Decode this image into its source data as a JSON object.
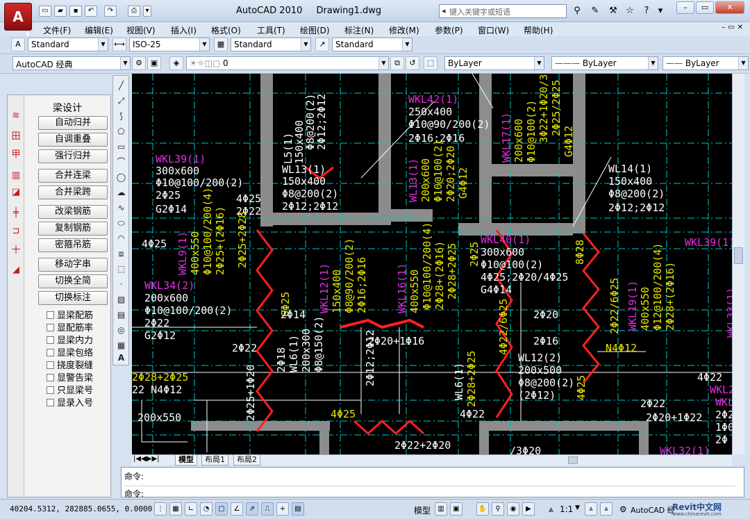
{
  "window": {
    "app_name": "AutoCAD 2010",
    "doc_name": "Drawing1.dwg",
    "search_placeholder": "键入关键字或短语",
    "logo_letter": "A"
  },
  "menu": [
    "文件(F)",
    "编辑(E)",
    "视图(V)",
    "插入(I)",
    "格式(O)",
    "工具(T)",
    "绘图(D)",
    "标注(N)",
    "修改(M)",
    "参数(P)",
    "窗口(W)",
    "帮助(H)"
  ],
  "styles_toolbar": {
    "text_style": "Standard",
    "dim_style": "ISO-25",
    "table_style": "Standard",
    "mleader_style": "Standard"
  },
  "workspace_toolbar": {
    "workspace": "AutoCAD 经典",
    "layer": "0",
    "color": "ByLayer",
    "linetype": "ByLayer",
    "lineweight": "ByLayer"
  },
  "beam_panel": {
    "title": "梁设计",
    "buttons": [
      "自动归并",
      "自调重叠",
      "强行归并",
      "合并连梁",
      "合并梁跨",
      "改梁钢筋",
      "复制钢筋",
      "密箍吊筋",
      "移动字串",
      "切换全简",
      "切换标注"
    ],
    "checkboxes": [
      "显梁配筋",
      "显配筋率",
      "显梁内力",
      "显梁包络",
      "挠度裂缝",
      "显警告梁",
      "只显梁号",
      "显录入号"
    ]
  },
  "layout_tabs": [
    "模型",
    "布局1",
    "布局2"
  ],
  "command": {
    "line1": "命令:",
    "line2": "命令:"
  },
  "status": {
    "coords": "40204.5312, 282885.0655, 0.0000",
    "model_label": "模型",
    "scale": "1:1",
    "workspace_label": "AutoCAD 经"
  },
  "watermark": {
    "title": "Revit中文网",
    "url": "www.chinarevit.com"
  },
  "drawing": {
    "colors": {
      "background": "#000000",
      "white": "#ffffff",
      "magenta": "#e02ee0",
      "yellow": "#e6e600",
      "cyan": "#00c8c8",
      "red": "#ff2020",
      "gray": "#8c8c8c"
    },
    "labels": [
      {
        "text": "WKL39(1)",
        "color": "magenta"
      },
      {
        "text": "300x600",
        "color": "white"
      },
      {
        "text": "Φ10@100/200(2)",
        "color": "white"
      },
      {
        "text": "2Φ25",
        "color": "white"
      },
      {
        "text": "G2Φ14",
        "color": "white"
      },
      {
        "text": "4Φ25",
        "color": "white"
      },
      {
        "text": "2Φ22",
        "color": "white"
      },
      {
        "text": "4Φ25",
        "color": "white"
      },
      {
        "text": "L5(1)",
        "color": "white"
      },
      {
        "text": "150x400",
        "color": "white"
      },
      {
        "text": "Φ8@200(2)",
        "color": "white"
      },
      {
        "text": "2Φ12;2Φ12",
        "color": "white"
      },
      {
        "text": "WL13(1)",
        "color": "white"
      },
      {
        "text": "150x400",
        "color": "white"
      },
      {
        "text": "Φ8@200(2)",
        "color": "white"
      },
      {
        "text": "2Φ12;2Φ12",
        "color": "white"
      },
      {
        "text": "WKL42(1)",
        "color": "magenta"
      },
      {
        "text": "250x400",
        "color": "white"
      },
      {
        "text": "Φ10@90/200(2)",
        "color": "white"
      },
      {
        "text": "2Φ16;2Φ16",
        "color": "white"
      },
      {
        "text": "WL13(1)",
        "color": "magenta"
      },
      {
        "text": "200x600",
        "color": "yellow"
      },
      {
        "text": "Φ10@100(2)",
        "color": "yellow"
      },
      {
        "text": "2Φ20;2Φ20",
        "color": "yellow"
      },
      {
        "text": "G4Φ12",
        "color": "yellow"
      },
      {
        "text": "WKL17(1)",
        "color": "magenta"
      },
      {
        "text": "200x600",
        "color": "yellow"
      },
      {
        "text": "Φ10@100(2)",
        "color": "yellow"
      },
      {
        "text": "3Φ22+1Φ20/3Φ20",
        "color": "yellow"
      },
      {
        "text": "2Φ25/2Φ25",
        "color": "yellow"
      },
      {
        "text": "G4Φ12",
        "color": "yellow"
      },
      {
        "text": "WL14(1)",
        "color": "white"
      },
      {
        "text": "150x400",
        "color": "white"
      },
      {
        "text": "Φ8@200(2)",
        "color": "white"
      },
      {
        "text": "2Φ12;2Φ12",
        "color": "white"
      },
      {
        "text": "WKL39(1)",
        "color": "magenta"
      },
      {
        "text": "WKL9(1)",
        "color": "magenta"
      },
      {
        "text": "400x550",
        "color": "yellow"
      },
      {
        "text": "Φ10@100/200(4)",
        "color": "yellow"
      },
      {
        "text": "2Φ25+(2Φ16)",
        "color": "yellow"
      },
      {
        "text": "2Φ25+2Φ28",
        "color": "yellow"
      },
      {
        "text": "WKL34(2)",
        "color": "magenta"
      },
      {
        "text": "200x600",
        "color": "white"
      },
      {
        "text": "Φ10@100/200(2)",
        "color": "white"
      },
      {
        "text": "2Φ22",
        "color": "white"
      },
      {
        "text": "G2Φ12",
        "color": "white"
      },
      {
        "text": "6Φ25",
        "color": "yellow"
      },
      {
        "text": "2Φ14",
        "color": "white"
      },
      {
        "text": "2Φ22",
        "color": "white"
      },
      {
        "text": "WKL12(1)",
        "color": "magenta"
      },
      {
        "text": "150x400",
        "color": "yellow"
      },
      {
        "text": "Φ8@90/200(2)",
        "color": "yellow"
      },
      {
        "text": "2Φ16;2Φ16",
        "color": "yellow"
      },
      {
        "text": "WKL16(1)",
        "color": "magenta"
      },
      {
        "text": "400x550",
        "color": "yellow"
      },
      {
        "text": "Φ10@100/200(4)",
        "color": "yellow"
      },
      {
        "text": "2Φ28+(2Φ16)",
        "color": "yellow"
      },
      {
        "text": "2Φ28+2Φ25",
        "color": "yellow"
      },
      {
        "text": "WKL40(1)",
        "color": "magenta"
      },
      {
        "text": "300x600",
        "color": "white"
      },
      {
        "text": "Φ10@100(2)",
        "color": "white"
      },
      {
        "text": "4Φ25;2Φ20/4Φ25",
        "color": "white"
      },
      {
        "text": "G4Φ14",
        "color": "white"
      },
      {
        "text": "8Φ28",
        "color": "yellow"
      },
      {
        "text": "2Φ25",
        "color": "yellow"
      },
      {
        "text": "2Φ20",
        "color": "white"
      },
      {
        "text": "2Φ16",
        "color": "white"
      },
      {
        "text": "4Φ22/6Φ25",
        "color": "yellow"
      },
      {
        "text": "WL12(2)",
        "color": "white"
      },
      {
        "text": "200x500",
        "color": "white"
      },
      {
        "text": "Φ8@200(2)",
        "color": "white"
      },
      {
        "text": "(2Φ12)",
        "color": "white"
      },
      {
        "text": "2Φ22/6Φ25",
        "color": "yellow"
      },
      {
        "text": "WKL19(1)",
        "color": "magenta"
      },
      {
        "text": "400x550",
        "color": "yellow"
      },
      {
        "text": "Φ12@100/200(4)",
        "color": "yellow"
      },
      {
        "text": "2Φ28+(2Φ16)",
        "color": "yellow"
      },
      {
        "text": "N4Φ12",
        "color": "yellow"
      },
      {
        "text": "2Φ20+1Φ16",
        "color": "white"
      },
      {
        "text": "2Φ18",
        "color": "white"
      },
      {
        "text": "WL6(1)",
        "color": "white"
      },
      {
        "text": "200x300",
        "color": "white"
      },
      {
        "text": "Φ8@150(2)",
        "color": "white"
      },
      {
        "text": "2Φ12;2Φ12",
        "color": "white"
      },
      {
        "text": "WL6(1)",
        "color": "white"
      },
      {
        "text": "2Φ28+2Φ25",
        "color": "yellow"
      },
      {
        "text": "4Φ25",
        "color": "yellow"
      },
      {
        "text": "2Φ28+2Φ25",
        "color": "yellow"
      },
      {
        "text": "22 N4Φ12",
        "color": "white"
      },
      {
        "text": "200x550",
        "color": "white"
      },
      {
        "text": "2Φ25+1Φ20",
        "color": "white"
      },
      {
        "text": "4Φ25",
        "color": "yellow"
      },
      {
        "text": "2Φ22+2Φ20",
        "color": "white"
      },
      {
        "text": "4Φ22",
        "color": "white"
      },
      {
        "text": "4Φ22",
        "color": "white"
      },
      {
        "text": "2Φ22",
        "color": "white"
      },
      {
        "text": "2Φ20+1Φ22",
        "color": "white"
      },
      {
        "text": "/3Φ20",
        "color": "white"
      },
      {
        "text": "WKL32(1)",
        "color": "magenta"
      },
      {
        "text": "WKL33(1)",
        "color": "magenta"
      },
      {
        "text": "WKL22(1)",
        "color": "magenta"
      },
      {
        "text": "WKL",
        "color": "magenta"
      },
      {
        "text": "2Φ25",
        "color": "white"
      },
      {
        "text": "1Φ0",
        "color": "white"
      },
      {
        "text": "2Φ",
        "color": "white"
      },
      {
        "text": "Φ1",
        "color": "white"
      }
    ]
  }
}
